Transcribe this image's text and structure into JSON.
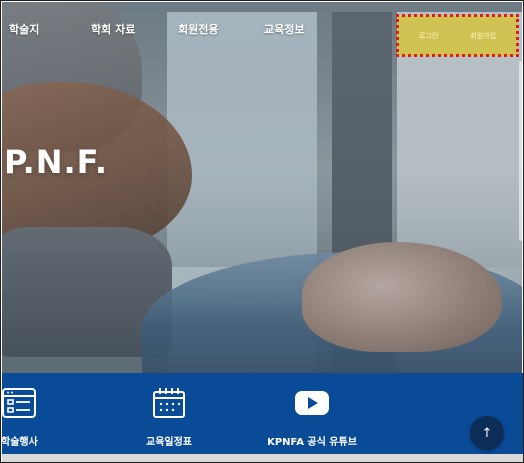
{
  "nav": {
    "items": [
      {
        "label": "학술지"
      },
      {
        "label": "학회 자료"
      },
      {
        "label": "회원전용"
      },
      {
        "label": "교육정보"
      }
    ],
    "login_label": "로그인",
    "signup_label": "회원가입"
  },
  "hero": {
    "title": "P.N.F."
  },
  "quick_menu": {
    "items": [
      {
        "label": "학술행사",
        "icon": "academic-event-icon"
      },
      {
        "label": "교육일정표",
        "icon": "calendar-icon"
      },
      {
        "label": "KPNFA 공식 유튜브",
        "icon": "youtube-icon"
      }
    ]
  },
  "colors": {
    "quick_menu_bg": "#0a4b98",
    "top_button_bg": "#0c2d57",
    "auth_highlight": "#dac428",
    "auth_outline": "#e01b1b"
  }
}
